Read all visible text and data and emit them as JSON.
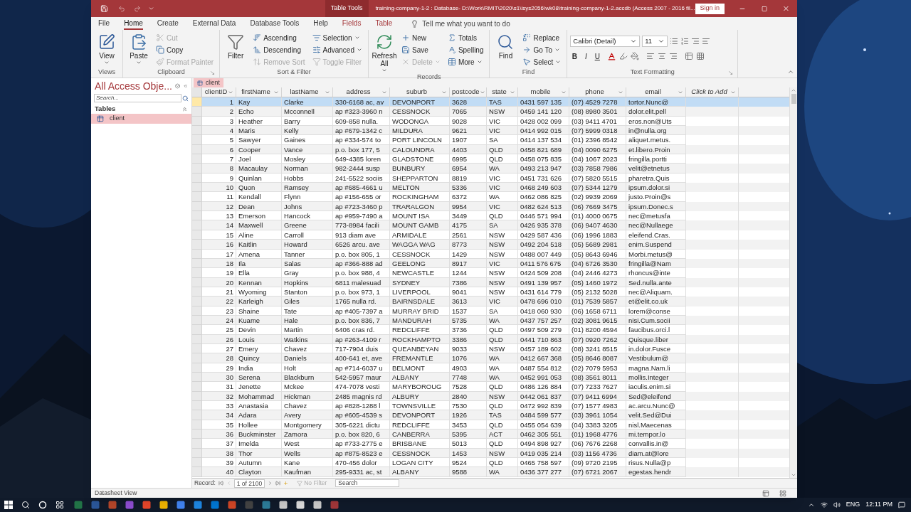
{
  "window": {
    "context_tab": "Table Tools",
    "title": "training-company-1-2 : Database- D:\\Work\\RMIT\\2020\\s1\\isys2056\\wk08\\training-company-1-2.accdb (Access 2007 - 2016 fil...",
    "sign_in": "Sign in"
  },
  "menu_tabs": [
    {
      "label": "File",
      "selected": false,
      "kind": "normal"
    },
    {
      "label": "Home",
      "selected": true,
      "kind": "normal"
    },
    {
      "label": "Create",
      "selected": false,
      "kind": "normal"
    },
    {
      "label": "External Data",
      "selected": false,
      "kind": "normal"
    },
    {
      "label": "Database Tools",
      "selected": false,
      "kind": "normal"
    },
    {
      "label": "Help",
      "selected": false,
      "kind": "normal"
    },
    {
      "label": "Fields",
      "selected": false,
      "kind": "contextual"
    },
    {
      "label": "Table",
      "selected": false,
      "kind": "contextual"
    }
  ],
  "tell_me": {
    "placeholder": "Tell me what you want to do"
  },
  "ribbon_groups": [
    {
      "kind": "standard",
      "label": "Views",
      "dialog_launcher": false,
      "columns": [
        [
          {
            "kind": "large",
            "label": "View",
            "disabled": false,
            "dropdown": true
          }
        ]
      ]
    },
    {
      "kind": "standard",
      "label": "Clipboard",
      "dialog_launcher": true,
      "columns": [
        [
          {
            "kind": "large",
            "label": "Paste",
            "disabled": false,
            "dropdown": true
          }
        ],
        [
          {
            "kind": "small",
            "label": "Cut",
            "disabled": true,
            "dropdown": false
          },
          {
            "kind": "small",
            "label": "Copy",
            "disabled": false,
            "dropdown": false
          },
          {
            "kind": "small",
            "label": "Format Painter",
            "disabled": true,
            "dropdown": false
          }
        ]
      ]
    },
    {
      "kind": "standard",
      "label": "Sort & Filter",
      "dialog_launcher": false,
      "columns": [
        [
          {
            "kind": "large",
            "label": "Filter",
            "disabled": false,
            "dropdown": false
          }
        ],
        [
          {
            "kind": "small",
            "label": "Ascending",
            "disabled": false,
            "dropdown": false
          },
          {
            "kind": "small",
            "label": "Descending",
            "disabled": false,
            "dropdown": false
          },
          {
            "kind": "small",
            "label": "Remove Sort",
            "disabled": true,
            "dropdown": false
          }
        ],
        [
          {
            "kind": "small",
            "label": "Selection",
            "disabled": false,
            "dropdown": true
          },
          {
            "kind": "small",
            "label": "Advanced",
            "disabled": false,
            "dropdown": true
          },
          {
            "kind": "small",
            "label": "Toggle Filter",
            "disabled": true,
            "dropdown": false
          }
        ]
      ]
    },
    {
      "kind": "standard",
      "label": "Records",
      "dialog_launcher": false,
      "columns": [
        [
          {
            "kind": "large",
            "label": "Refresh All",
            "disabled": false,
            "dropdown": true
          }
        ],
        [
          {
            "kind": "small",
            "label": "New",
            "disabled": false,
            "dropdown": false
          },
          {
            "kind": "small",
            "label": "Save",
            "disabled": false,
            "dropdown": false
          },
          {
            "kind": "small",
            "label": "Delete",
            "disabled": true,
            "dropdown": true
          }
        ],
        [
          {
            "kind": "small",
            "label": "Totals",
            "disabled": false,
            "dropdown": false
          },
          {
            "kind": "small",
            "label": "Spelling",
            "disabled": false,
            "dropdown": false
          },
          {
            "kind": "small",
            "label": "More",
            "disabled": false,
            "dropdown": true
          }
        ]
      ]
    },
    {
      "kind": "standard",
      "label": "Find",
      "dialog_launcher": false,
      "columns": [
        [
          {
            "kind": "large",
            "label": "Find",
            "disabled": false,
            "dropdown": false
          }
        ],
        [
          {
            "kind": "small",
            "label": "Replace",
            "disabled": false,
            "dropdown": false
          },
          {
            "kind": "small",
            "label": "Go To",
            "disabled": false,
            "dropdown": true
          },
          {
            "kind": "small",
            "label": "Select",
            "disabled": false,
            "dropdown": true
          }
        ]
      ]
    },
    {
      "kind": "text_formatting",
      "label": "Text Formatting",
      "dialog_launcher": true,
      "font_name": "Calibri (Detail)",
      "font_size": "11",
      "format_buttons": [
        {
          "label": "B",
          "kind": "bold"
        },
        {
          "label": "I",
          "kind": "italic"
        },
        {
          "label": "U",
          "kind": "underline"
        }
      ]
    }
  ],
  "nav_pane": {
    "title": "All Access Obje...",
    "search": {
      "placeholder": "Search..."
    },
    "section": "Tables",
    "items": [
      {
        "label": "client",
        "selected": true
      }
    ]
  },
  "document_tab": {
    "label": "client"
  },
  "table": {
    "columns": [
      "clientID",
      "firstName",
      "lastName",
      "address",
      "suburb",
      "postcode",
      "state",
      "mobile",
      "phone",
      "email",
      "Click to Add"
    ],
    "rows": [
      {
        "selected": true,
        "cells": [
          "1",
          "Kay",
          "Clarke",
          "330-6168 ac, av",
          "DEVONPORT",
          "3628",
          "TAS",
          "0431 597 135",
          "(07) 4529 7278",
          "tortor.Nunc@"
        ]
      },
      {
        "selected": false,
        "cells": [
          "2",
          "Echo",
          "Mcconnell",
          "ap #323-3960 n",
          "CESSNOCK",
          "7065",
          "NSW",
          "0459 141 120",
          "(08) 8980 3501",
          "dolor.elit.pell"
        ]
      },
      {
        "selected": false,
        "cells": [
          "3",
          "Heather",
          "Barry",
          "609-858 nulla.",
          "WODONGA",
          "9028",
          "VIC",
          "0428 002 099",
          "(03) 9411 4701",
          "eros.non@Uts"
        ]
      },
      {
        "selected": false,
        "cells": [
          "4",
          "Maris",
          "Kelly",
          "ap #679-1342 c",
          "MILDURA",
          "9621",
          "VIC",
          "0414 992 015",
          "(07) 5999 0318",
          "in@nulla.org"
        ]
      },
      {
        "selected": false,
        "cells": [
          "5",
          "Sawyer",
          "Gaines",
          "ap #334-574 to",
          "PORT LINCOLN",
          "1907",
          "SA",
          "0414 137 534",
          "(01) 2396 8542",
          "aliquet.metus."
        ]
      },
      {
        "selected": false,
        "cells": [
          "6",
          "Cooper",
          "Vance",
          "p.o. box 177, 5",
          "CALOUNDRA",
          "4403",
          "QLD",
          "0458 821 689",
          "(04) 0090 6275",
          "et.libero.Proin"
        ]
      },
      {
        "selected": false,
        "cells": [
          "7",
          "Joel",
          "Mosley",
          "649-4385 loren",
          "GLADSTONE",
          "6995",
          "QLD",
          "0458 075 835",
          "(04) 1067 2023",
          "fringilla.portti"
        ]
      },
      {
        "selected": false,
        "cells": [
          "8",
          "Macaulay",
          "Norman",
          "982-2444 susp",
          "BUNBURY",
          "6954",
          "WA",
          "0493 213 947",
          "(03) 7858 7986",
          "velit@etnetus"
        ]
      },
      {
        "selected": false,
        "cells": [
          "9",
          "Quinlan",
          "Hobbs",
          "241-5522 sociis",
          "SHEPPARTON",
          "8819",
          "VIC",
          "0451 731 626",
          "(07) 5820 5515",
          "pharetra.Quis"
        ]
      },
      {
        "selected": false,
        "cells": [
          "10",
          "Quon",
          "Ramsey",
          "ap #685-4661 u",
          "MELTON",
          "5336",
          "VIC",
          "0468 249 603",
          "(07) 5344 1279",
          "ipsum.dolor.si"
        ]
      },
      {
        "selected": false,
        "cells": [
          "11",
          "Kendall",
          "Flynn",
          "ap #156-655 or",
          "ROCKINGHAM",
          "6372",
          "WA",
          "0462 086 825",
          "(02) 9939 2069",
          "justo.Proin@s"
        ]
      },
      {
        "selected": false,
        "cells": [
          "12",
          "Dean",
          "Johns",
          "ap #723-3460 p",
          "TRARALGON",
          "9954",
          "VIC",
          "0482 624 513",
          "(06) 7669 3475",
          "ipsum.Donec.s"
        ]
      },
      {
        "selected": false,
        "cells": [
          "13",
          "Emerson",
          "Hancock",
          "ap #959-7490 a",
          "MOUNT ISA",
          "3449",
          "QLD",
          "0446 571 994",
          "(01) 4000 0675",
          "nec@metusfa"
        ]
      },
      {
        "selected": false,
        "cells": [
          "14",
          "Maxwell",
          "Greene",
          "773-8984 facili",
          "MOUNT GAMB",
          "4175",
          "SA",
          "0426 935 378",
          "(06) 9407 4630",
          "nec@Nullaege"
        ]
      },
      {
        "selected": false,
        "cells": [
          "15",
          "Aline",
          "Carroll",
          "913 diam ave",
          "ARMIDALE",
          "2561",
          "NSW",
          "0429 587 436",
          "(06) 1996 1883",
          "eleifend.Cras."
        ]
      },
      {
        "selected": false,
        "cells": [
          "16",
          "Kaitlin",
          "Howard",
          "6526 arcu. ave",
          "WAGGA WAG",
          "8773",
          "NSW",
          "0492 204 518",
          "(05) 5689 2981",
          "enim.Suspend"
        ]
      },
      {
        "selected": false,
        "cells": [
          "17",
          "Amena",
          "Tanner",
          "p.o. box 805, 1",
          "CESSNOCK",
          "1429",
          "NSW",
          "0488 007 449",
          "(05) 8643 6946",
          "Morbi.metus@"
        ]
      },
      {
        "selected": false,
        "cells": [
          "18",
          "Ila",
          "Salas",
          "ap #366-888 ad",
          "GEELONG",
          "8917",
          "VIC",
          "0411 576 675",
          "(04) 6726 3530",
          "fringilla@Nam"
        ]
      },
      {
        "selected": false,
        "cells": [
          "19",
          "Ella",
          "Gray",
          "p.o. box 988, 4",
          "NEWCASTLE",
          "1244",
          "NSW",
          "0424 509 208",
          "(04) 2446 4273",
          "rhoncus@inte"
        ]
      },
      {
        "selected": false,
        "cells": [
          "20",
          "Kennan",
          "Hopkins",
          "6811 malesuad",
          "SYDNEY",
          "7386",
          "NSW",
          "0491 139 957",
          "(05) 1460 1972",
          "Sed.nulla.ante"
        ]
      },
      {
        "selected": false,
        "cells": [
          "21",
          "Wyoming",
          "Stanton",
          "p.o. box 973, 1",
          "LIVERPOOL",
          "9041",
          "NSW",
          "0431 614 779",
          "(05) 2132 5028",
          "nec@Aliquam."
        ]
      },
      {
        "selected": false,
        "cells": [
          "22",
          "Karleigh",
          "Giles",
          "1765 nulla rd.",
          "BAIRNSDALE",
          "3613",
          "VIC",
          "0478 696 010",
          "(01) 7539 5857",
          "et@elit.co.uk"
        ]
      },
      {
        "selected": false,
        "cells": [
          "23",
          "Shaine",
          "Tate",
          "ap #405-7397 a",
          "MURRAY BRID",
          "1537",
          "SA",
          "0418 060 930",
          "(06) 1658 6711",
          "lorem@conse"
        ]
      },
      {
        "selected": false,
        "cells": [
          "24",
          "Kuame",
          "Hale",
          "p.o. box 836, 7",
          "MANDURAH",
          "5735",
          "WA",
          "0437 757 257",
          "(02) 3081 9615",
          "nisi.Cum.socii"
        ]
      },
      {
        "selected": false,
        "cells": [
          "25",
          "Devin",
          "Martin",
          "6406 cras rd.",
          "REDCLIFFE",
          "3736",
          "QLD",
          "0497 509 279",
          "(01) 8200 4594",
          "faucibus.orci.l"
        ]
      },
      {
        "selected": false,
        "cells": [
          "26",
          "Louis",
          "Watkins",
          "ap #263-4109 r",
          "ROCKHAMPTO",
          "3386",
          "QLD",
          "0441 710 863",
          "(07) 0920 7262",
          "Quisque.liber"
        ]
      },
      {
        "selected": false,
        "cells": [
          "27",
          "Emery",
          "Chavez",
          "717-7904 duis",
          "QUEANBEYAN",
          "9033",
          "NSW",
          "0457 189 602",
          "(08) 3241 8515",
          "in.dolor.Fusce"
        ]
      },
      {
        "selected": false,
        "cells": [
          "28",
          "Quincy",
          "Daniels",
          "400-641 et, ave",
          "FREMANTLE",
          "1076",
          "WA",
          "0412 667 368",
          "(05) 8646 8087",
          "Vestibulum@"
        ]
      },
      {
        "selected": false,
        "cells": [
          "29",
          "India",
          "Holt",
          "ap #714-6037 u",
          "BELMONT",
          "4903",
          "WA",
          "0487 554 812",
          "(02) 7079 5953",
          "magna.Nam.li"
        ]
      },
      {
        "selected": false,
        "cells": [
          "30",
          "Serena",
          "Blackburn",
          "542-5957 maur",
          "ALBANY",
          "7748",
          "WA",
          "0452 991 053",
          "(08) 3561 8011",
          "mollis.Integer"
        ]
      },
      {
        "selected": false,
        "cells": [
          "31",
          "Jenette",
          "Mckee",
          "474-7078 vesti",
          "MARYBOROUG",
          "7528",
          "QLD",
          "0486 126 884",
          "(07) 7233 7627",
          "iaculis.enim.si"
        ]
      },
      {
        "selected": false,
        "cells": [
          "32",
          "Mohammad",
          "Hickman",
          "2485 magnis rd",
          "ALBURY",
          "2840",
          "NSW",
          "0442 061 837",
          "(07) 9411 6994",
          "Sed@eleifend"
        ]
      },
      {
        "selected": false,
        "cells": [
          "33",
          "Anastasia",
          "Chavez",
          "ap #828-1288 l",
          "TOWNSVILLE",
          "7530",
          "QLD",
          "0472 992 839",
          "(07) 1577 4983",
          "ac.arcu.Nunc@"
        ]
      },
      {
        "selected": false,
        "cells": [
          "34",
          "Adara",
          "Avery",
          "ap #605-4539 s",
          "DEVONPORT",
          "1926",
          "TAS",
          "0484 599 577",
          "(03) 3961 1054",
          "velit.Sed@Dui"
        ]
      },
      {
        "selected": false,
        "cells": [
          "35",
          "Hollee",
          "Montgomery",
          "305-6221 dictu",
          "REDCLIFFE",
          "3453",
          "QLD",
          "0455 054 639",
          "(04) 3383 3205",
          "nisl.Maecenas"
        ]
      },
      {
        "selected": false,
        "cells": [
          "36",
          "Buckminster",
          "Zamora",
          "p.o. box 820, 6",
          "CANBERRA",
          "5395",
          "ACT",
          "0462 305 551",
          "(01) 1968 4776",
          "mi.tempor.lo"
        ]
      },
      {
        "selected": false,
        "cells": [
          "37",
          "Imelda",
          "West",
          "ap #733-2775 e",
          "BRISBANE",
          "5013",
          "QLD",
          "0494 898 927",
          "(06) 7676 2268",
          "convallis.in@"
        ]
      },
      {
        "selected": false,
        "cells": [
          "38",
          "Thor",
          "Wells",
          "ap #875-8523 e",
          "CESSNOCK",
          "1453",
          "NSW",
          "0419 035 214",
          "(03) 1156 4736",
          "diam.at@lore"
        ]
      },
      {
        "selected": false,
        "cells": [
          "39",
          "Autumn",
          "Kane",
          "470-456 dolor",
          "LOGAN CITY",
          "9524",
          "QLD",
          "0465 758 597",
          "(09) 9720 2195",
          "risus.Nulla@p"
        ]
      },
      {
        "selected": false,
        "cells": [
          "40",
          "Clayton",
          "Kaufman",
          "295-9331 ac, st",
          "ALBANY",
          "9588",
          "WA",
          "0436 377 277",
          "(07) 6721 2067",
          "egestas.hendr"
        ]
      }
    ]
  },
  "record_bar": {
    "label": "Record:",
    "position": "1 of 2100",
    "filter": "No Filter",
    "search": {
      "placeholder": "Search"
    }
  },
  "status_bar": {
    "text": "Datasheet View"
  },
  "taskbar": {
    "language": "ENG",
    "time": "12:11 PM"
  }
}
